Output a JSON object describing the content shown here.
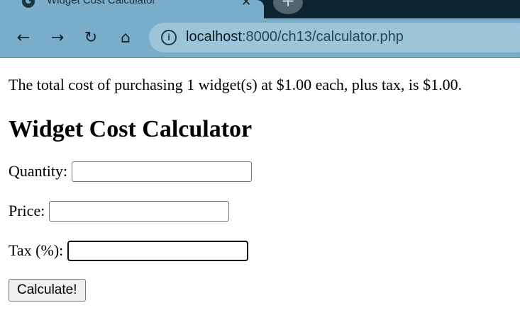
{
  "browser": {
    "tab_title": "Widget Cost Calculator",
    "tab_close_glyph": "✕",
    "new_tab_glyph": "+",
    "nav": {
      "back_glyph": "←",
      "forward_glyph": "→",
      "reload_glyph": "↻",
      "home_glyph": "⌂"
    },
    "info_glyph": "i",
    "url_host": "localhost",
    "url_rest": ":8000/ch13/calculator.php",
    "colors": {
      "tabstrip": "#0e2431",
      "toolbar": "#79adc9",
      "omnibox": "#9cc5d9"
    }
  },
  "page": {
    "result_text": "The total cost of purchasing 1 widget(s) at $1.00 each, plus tax, is $1.00.",
    "heading": "Widget Cost Calculator",
    "form": {
      "quantity_label": "Quantity:",
      "quantity_value": "",
      "price_label": "Price:",
      "price_value": "",
      "tax_label": "Tax (%):",
      "tax_value": "",
      "submit_label": "Calculate!"
    }
  }
}
